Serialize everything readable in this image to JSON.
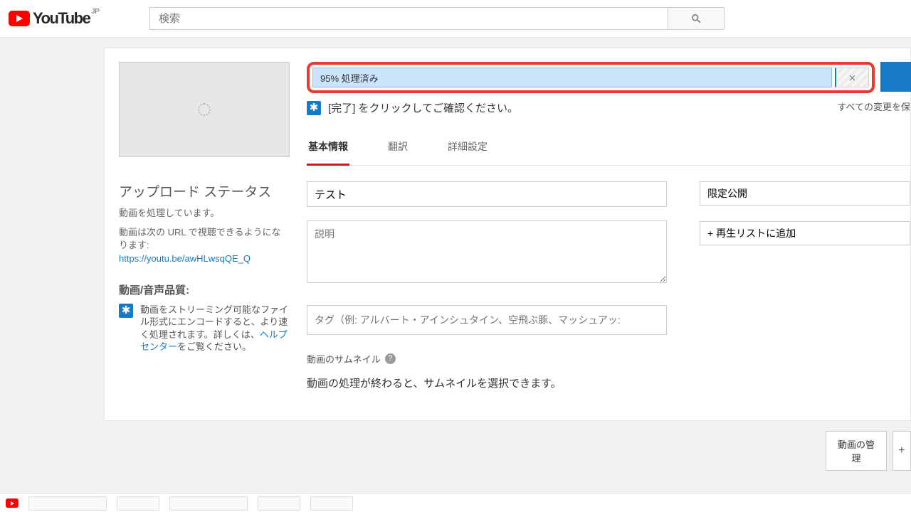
{
  "header": {
    "logo_jp": "JP",
    "logo_text": "YouTube",
    "search_placeholder": "検索"
  },
  "progress": {
    "text": "95% 処理済み"
  },
  "confirm": {
    "text": "[完了] をクリックしてご確認ください。"
  },
  "saved_note": "すべての変更を保",
  "tabs": {
    "basic": "基本情報",
    "translations": "翻訳",
    "advanced": "詳細設定"
  },
  "upload_status": {
    "heading": "アップロード ステータス",
    "processing": "動画を処理しています。",
    "watch_line1": "動画は次の URL で視聴できるようになります:",
    "url": "https://youtu.be/awHLwsqQE_Q"
  },
  "quality": {
    "heading": "動画/音声品質:",
    "tip_before": "動画をストリーミング可能なファイル形式にエンコードすると、より速く処理されます。詳しくは、",
    "tip_link": "ヘルプセンター",
    "tip_after": "をご覧ください。"
  },
  "form": {
    "title": "テスト",
    "description_placeholder": "説明",
    "tags_placeholder": "タグ（例: アルバート・アインシュタイン、空飛ぶ豚、マッシュアッ:"
  },
  "privacy": {
    "selected": "限定公開",
    "add_playlist": "+ 再生リストに追加"
  },
  "thumbnails": {
    "label": "動画のサムネイル",
    "message": "動画の処理が終わると、サムネイルを選択できます。"
  },
  "footer": {
    "manage": "動画の管理"
  }
}
